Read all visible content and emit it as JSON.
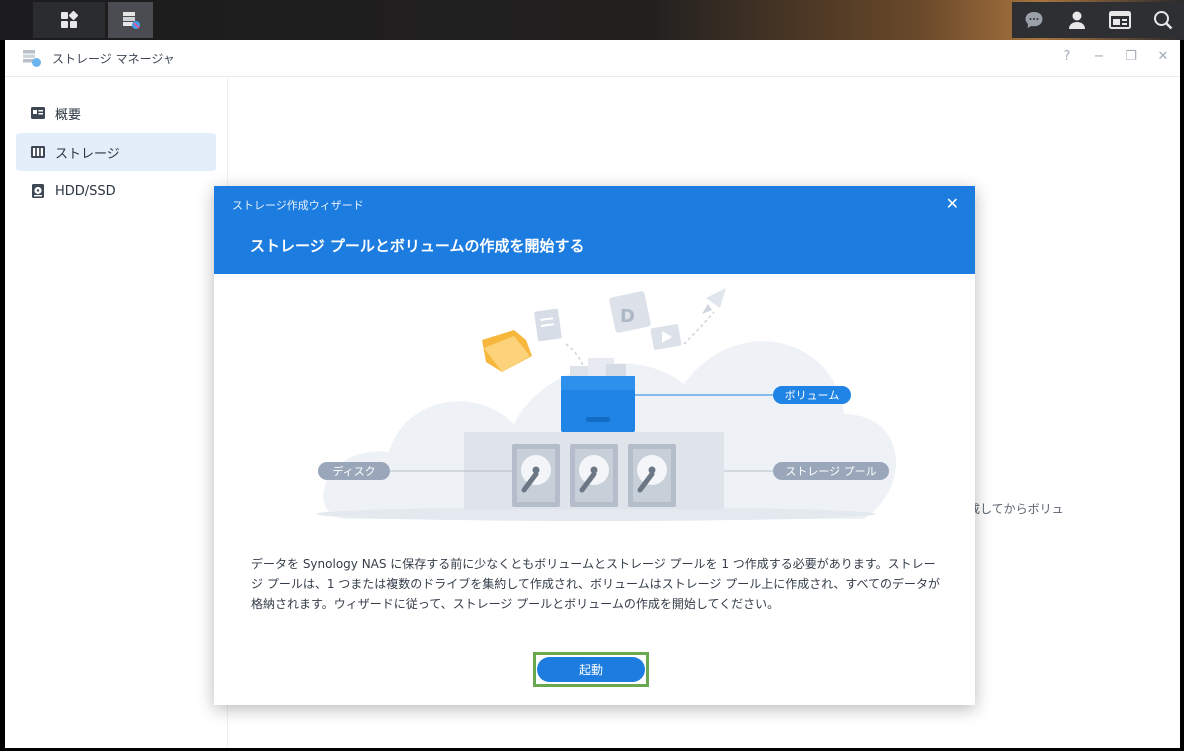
{
  "taskbar": {
    "main_menu_icon": "grid-icon",
    "app_icon": "storage-manager-icon",
    "right_icons": [
      "chat-icon",
      "user-icon",
      "widgets-icon",
      "search-icon"
    ]
  },
  "window": {
    "title": "ストレージ マネージャ",
    "controls": {
      "help": "?",
      "minimize": "−",
      "restore": "❐",
      "close": "✕"
    }
  },
  "sidebar": {
    "items": [
      {
        "label": "概要",
        "icon": "overview-icon"
      },
      {
        "label": "ストレージ",
        "icon": "storage-icon",
        "active": true
      },
      {
        "label": "HDD/SSD",
        "icon": "hdd-icon"
      }
    ]
  },
  "main": {
    "partial_text": "成してからボリュ"
  },
  "wizard": {
    "caption": "ストレージ作成ウィザード",
    "close": "✕",
    "title": "ストレージ プールとボリュームの作成を開始する",
    "labels": {
      "volume": "ボリューム",
      "disk": "ディスク",
      "storage_pool": "ストレージ プール"
    },
    "description": "データを Synology NAS に保存する前に少なくともボリュームとストレージ プールを 1 つ作成する必要があります。ストレージ プールは、1 つまたは複数のドライブを集約して作成され、ボリュームはストレージ プール上に作成され、すべてのデータが格納されます。ウィザードに従って、ストレージ プールとボリュームの作成を開始してください。",
    "start_button": "起動"
  },
  "colors": {
    "accent": "#1c7cdf",
    "highlight_border": "#6aa84f",
    "label_pill": "#9aa7ba"
  }
}
